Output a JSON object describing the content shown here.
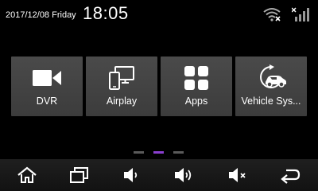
{
  "status_bar": {
    "date": "2017/12/08",
    "weekday": "Friday",
    "time": "18:05",
    "wifi_icon": "wifi-disconnected-icon",
    "signal_icon": "cellular-signal-no-service-icon"
  },
  "apps": [
    {
      "label": "DVR",
      "icon": "video-camera-icon"
    },
    {
      "label": "Airplay",
      "icon": "screen-mirroring-icon"
    },
    {
      "label": "Apps",
      "icon": "app-grid-icon"
    },
    {
      "label": "Vehicle Sys...",
      "icon": "vehicle-settings-icon"
    }
  ],
  "pager": {
    "pages": 3,
    "current_page": 2,
    "active_color": "#8a3fd0",
    "inactive_color": "#5a5a5a"
  },
  "navbar": {
    "buttons": [
      "home-icon",
      "recent-apps-icon",
      "volume-down-icon",
      "volume-up-icon",
      "mute-icon",
      "back-icon"
    ]
  },
  "colors": {
    "background": "#000000",
    "tile": "#444444",
    "navbar": "#1a1a1a"
  }
}
